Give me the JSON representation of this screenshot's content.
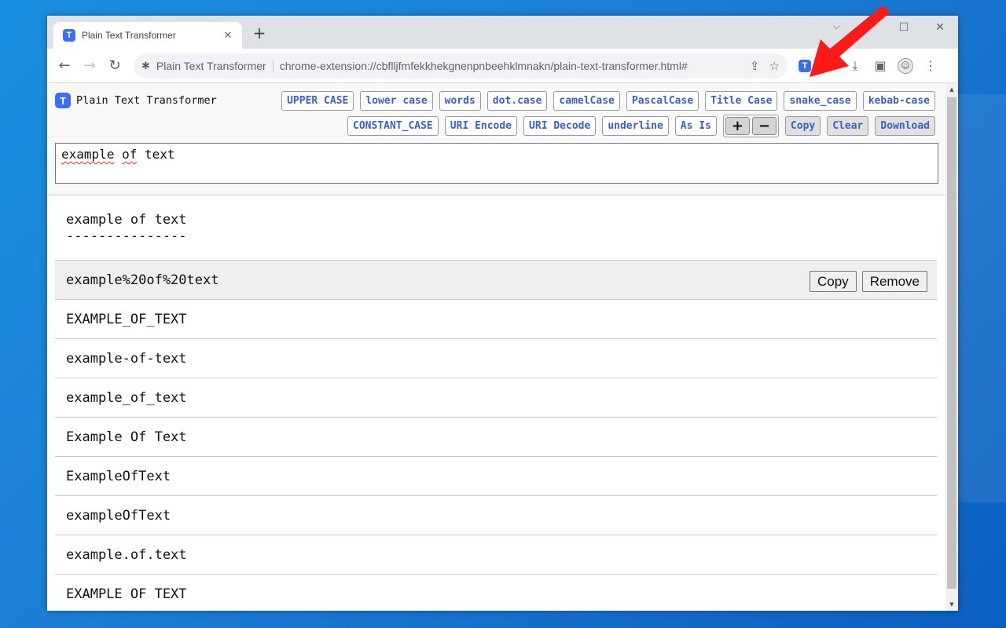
{
  "browser": {
    "tab_title": "Plain Text Transformer",
    "tab_icon_letter": "T",
    "new_tab": "+",
    "omnibox_site": "Plain Text Transformer",
    "omnibox_url": "chrome-extension://cbflljfmfekkhekgnenpnbeehklmnakn/plain-text-transformer.html#",
    "toolbar_icons": [
      "share-icon",
      "star-icon",
      "extension-active-icon",
      "puzzle-icon",
      "download-icon",
      "sidepanel-icon",
      "profile-avatar",
      "menu-icon"
    ]
  },
  "app": {
    "title": "Plain Text Transformer",
    "logo_letter": "T",
    "buttons_row1": [
      "UPPER CASE",
      "lower case",
      "words",
      "dot.case",
      "camelCase",
      "PascalCase",
      "Title Case",
      "snake_case",
      "kebab-case"
    ],
    "buttons_row2": [
      "CONSTANT_CASE",
      "URI Encode",
      "URI Decode",
      "underline",
      "As Is"
    ],
    "zoom_in": "+",
    "zoom_out": "−",
    "copy": "Copy",
    "clear": "Clear",
    "download": "Download",
    "input_value_words": [
      "example",
      "of",
      "text"
    ]
  },
  "results": {
    "first_line": "example of text",
    "first_underline": "---------------",
    "rows": [
      "example%20of%20text",
      "EXAMPLE_OF_TEXT",
      "example-of-text",
      "example_of_text",
      "Example Of Text",
      "ExampleOfText",
      "exampleOfText",
      "example.of.text",
      "EXAMPLE OF TEXT"
    ],
    "row_copy": "Copy",
    "row_remove": "Remove"
  },
  "colors": {
    "accent": "#3b6ef5",
    "button_text": "#3a5fcd",
    "arrow": "#ff1a1a"
  }
}
